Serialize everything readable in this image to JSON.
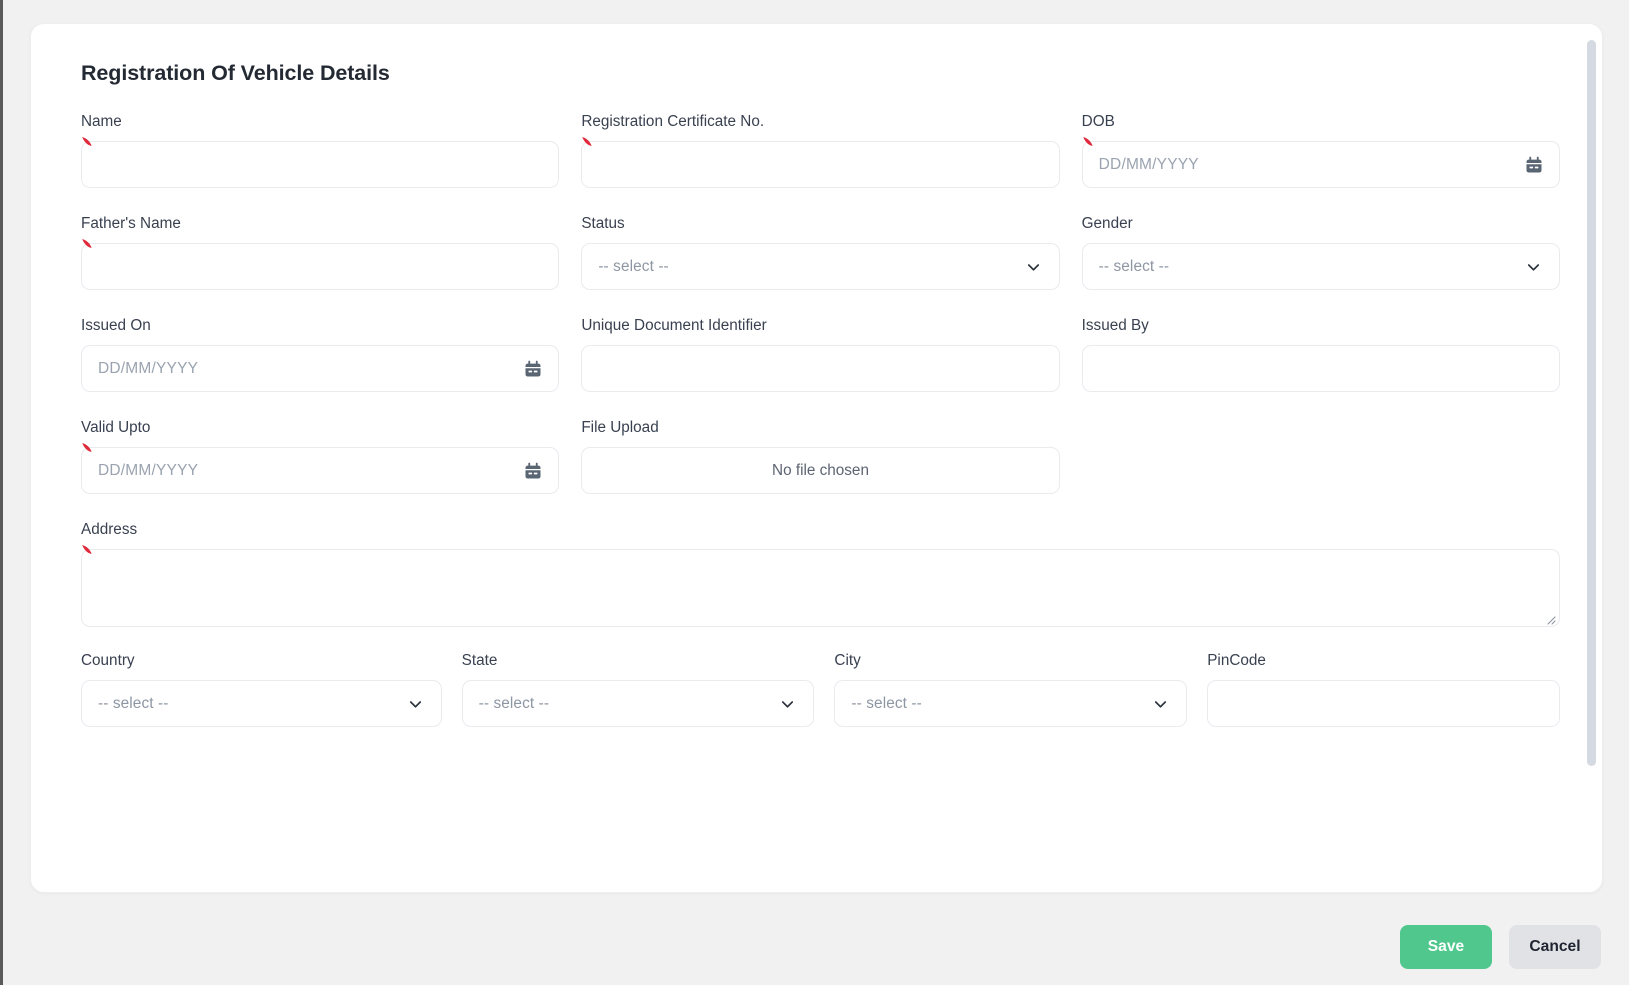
{
  "card": {
    "title": "Registration Of Vehicle Details"
  },
  "colors": {
    "save_button": "#4fc78d",
    "cancel_button": "#e1e2e5",
    "required_marker": "#e02a3c",
    "page_background": "#f1f1f1",
    "card_background": "#ffffff",
    "label_text": "#394150",
    "placeholder_text": "#9aa3af",
    "scrollbar_thumb": "#d5d9e2"
  },
  "fields": {
    "name": {
      "label": "Name",
      "value": "",
      "placeholder": "",
      "required": true,
      "type": "text"
    },
    "registration_certificate_no": {
      "label": "Registration Certificate No.",
      "value": "",
      "placeholder": "",
      "required": true,
      "type": "text"
    },
    "dob": {
      "label": "DOB",
      "value": "",
      "placeholder": "DD/MM/YYYY",
      "required": true,
      "type": "date",
      "icon": "calendar-icon"
    },
    "fathers_name": {
      "label": "Father's Name",
      "value": "",
      "placeholder": "",
      "required": true,
      "type": "text"
    },
    "status": {
      "label": "Status",
      "value": "-- select --",
      "required": false,
      "type": "select",
      "icon": "chevron-down-icon"
    },
    "gender": {
      "label": "Gender",
      "value": "-- select --",
      "required": false,
      "type": "select",
      "icon": "chevron-down-icon"
    },
    "issued_on": {
      "label": "Issued On",
      "value": "",
      "placeholder": "DD/MM/YYYY",
      "required": false,
      "type": "date",
      "icon": "calendar-icon"
    },
    "unique_document_identifier": {
      "label": "Unique Document Identifier",
      "value": "",
      "placeholder": "",
      "required": false,
      "type": "text"
    },
    "issued_by": {
      "label": "Issued By",
      "value": "",
      "placeholder": "",
      "required": false,
      "type": "text"
    },
    "valid_upto": {
      "label": "Valid Upto",
      "value": "",
      "placeholder": "DD/MM/YYYY",
      "required": true,
      "type": "date",
      "icon": "calendar-icon"
    },
    "file_upload": {
      "label": "File Upload",
      "value": "No file chosen",
      "required": false,
      "type": "file"
    },
    "address": {
      "label": "Address",
      "value": "",
      "placeholder": "",
      "required": true,
      "type": "textarea"
    },
    "country": {
      "label": "Country",
      "value": "-- select --",
      "required": false,
      "type": "select",
      "icon": "chevron-down-icon"
    },
    "state": {
      "label": "State",
      "value": "-- select --",
      "required": false,
      "type": "select",
      "icon": "chevron-down-icon"
    },
    "city": {
      "label": "City",
      "value": "-- select --",
      "required": false,
      "type": "select",
      "icon": "chevron-down-icon"
    },
    "pincode": {
      "label": "PinCode",
      "value": "",
      "placeholder": "",
      "required": false,
      "type": "text"
    }
  },
  "footer": {
    "save_label": "Save",
    "cancel_label": "Cancel"
  }
}
